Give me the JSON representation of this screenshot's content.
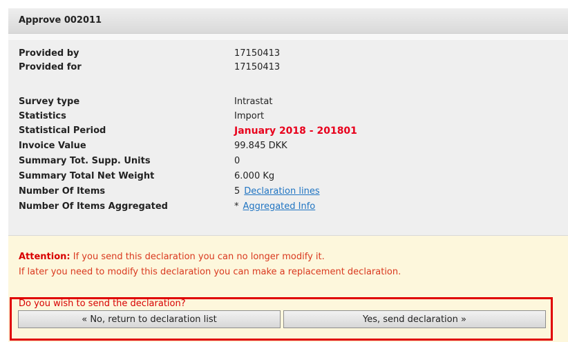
{
  "header": {
    "title": "Approve 002011"
  },
  "details_top": [
    {
      "label": "Provided by",
      "value": "17150413"
    },
    {
      "label": "Provided for",
      "value": "17150413"
    }
  ],
  "details": [
    {
      "label": "Survey type",
      "value": "Intrastat"
    },
    {
      "label": "Statistics",
      "value": "Import"
    },
    {
      "label": "Statistical Period",
      "value": "January 2018 - 201801"
    },
    {
      "label": "Invoice Value",
      "value": "99.845 DKK"
    },
    {
      "label": "Summary Tot. Supp. Units",
      "value": "0"
    },
    {
      "label": "Summary Total Net Weight",
      "value": "6.000 Kg"
    },
    {
      "label": "Number Of Items",
      "value": "5",
      "link": "Declaration lines"
    },
    {
      "label": "Number Of Items Aggregated",
      "value": "*",
      "link": "Aggregated Info"
    }
  ],
  "attention": {
    "prefix": "Attention:",
    "line1": " If you send this declaration you can no longer modify it.",
    "line2": "If later you need to modify this declaration you can make a replacement declaration.",
    "question": "Do you wish to send the declaration?"
  },
  "buttons": {
    "no": "« No, return to declaration list",
    "yes": "Yes, send declaration »"
  },
  "colors": {
    "attention_bg": "#fdf7dc",
    "alert_red": "#d80000",
    "link": "#1f74c2",
    "highlight": "#e00000"
  }
}
